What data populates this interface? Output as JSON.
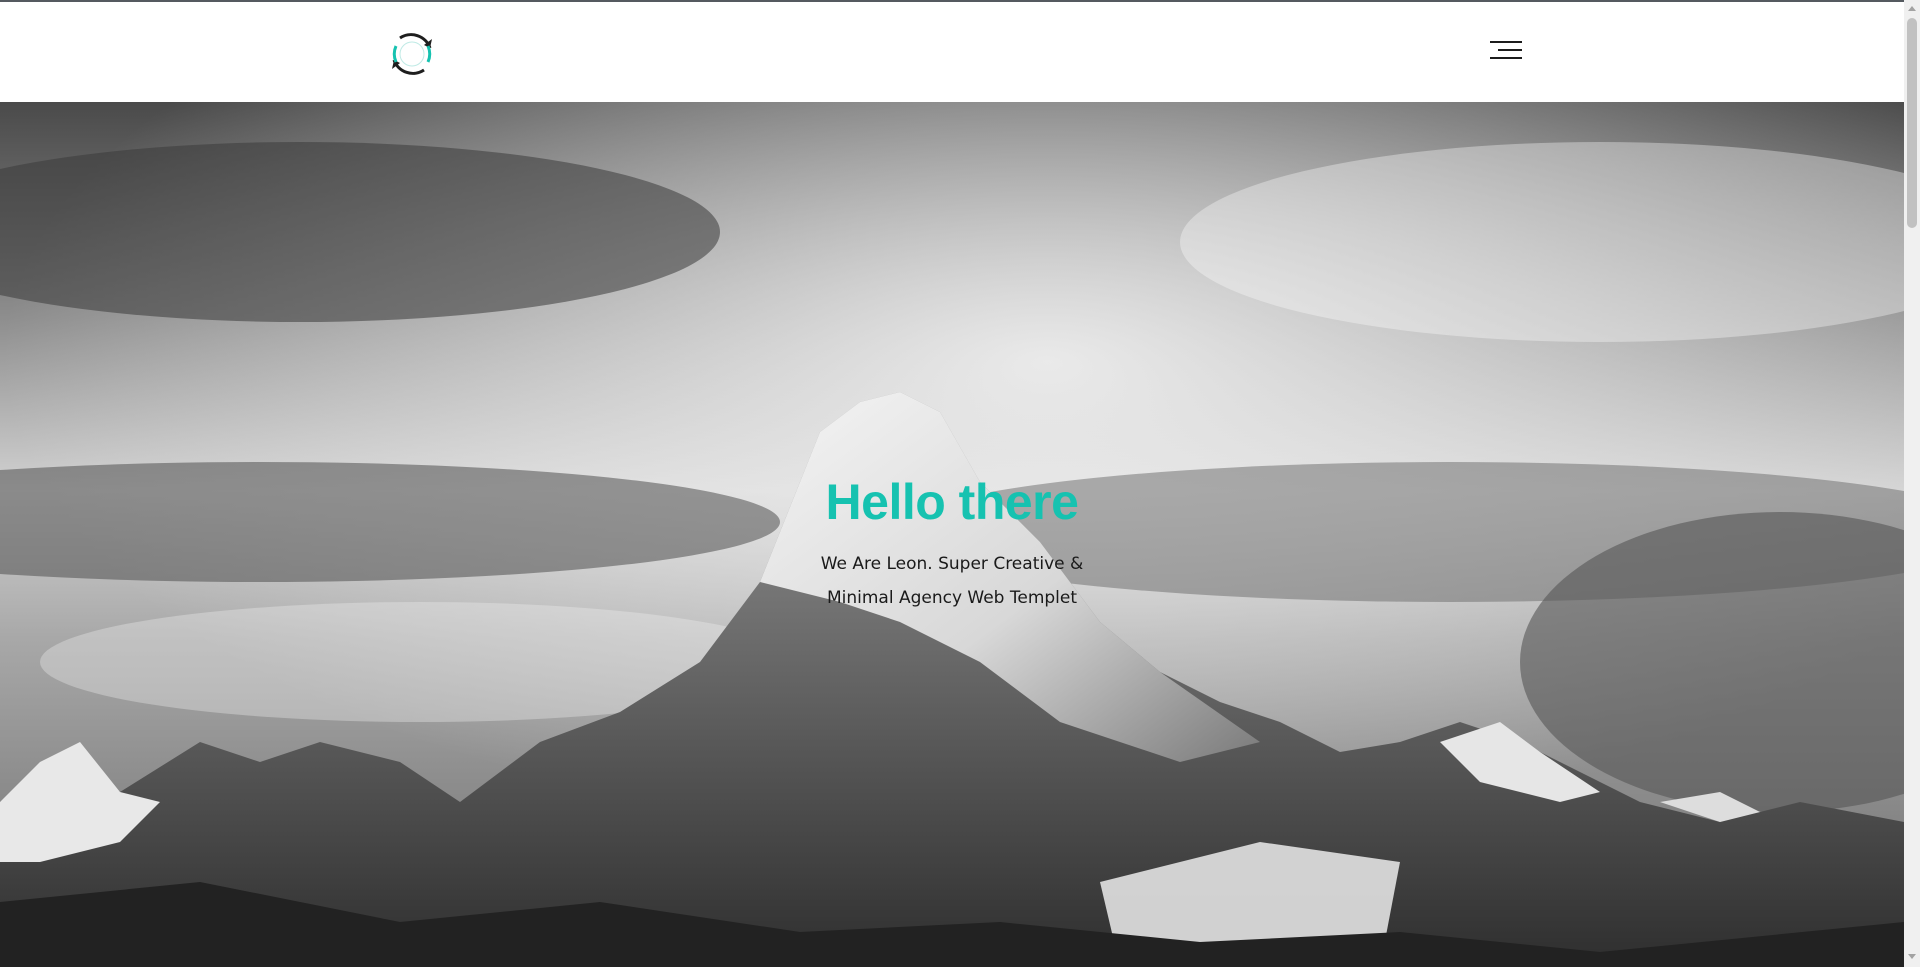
{
  "header": {
    "logo": "recycle-arrows-logo",
    "menu_icon": "hamburger-menu-icon"
  },
  "hero": {
    "title": "Hello there",
    "subtitle_line1": "We Are Leon. Super Creative &",
    "subtitle_line2": "Minimal Agency Web Templet",
    "background": "snowy-mountain-peak-black-and-white"
  },
  "colors": {
    "accent": "#16c2b0",
    "header_bg": "#ffffff",
    "text": "#1a1a1a"
  }
}
